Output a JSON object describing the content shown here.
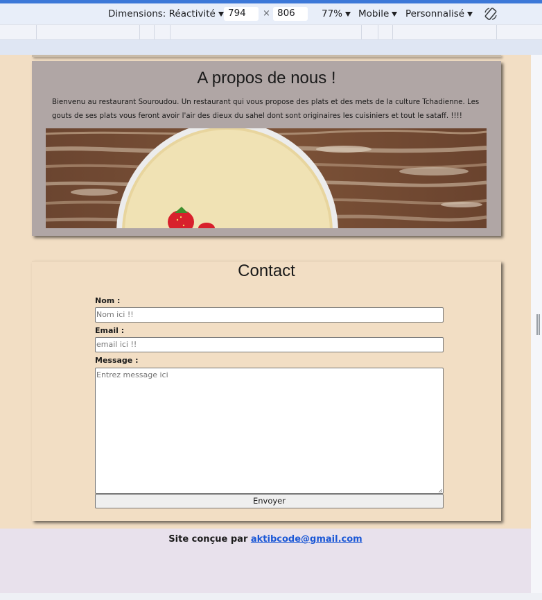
{
  "devtools": {
    "dimensions_label": "Dimensions: Réactivité",
    "width": "794",
    "height": "806",
    "times": "×",
    "zoom": "77%",
    "throttle": "Mobile",
    "custom": "Personnalisé",
    "accent": "#3c78d8"
  },
  "about": {
    "title": "A propos de nous !",
    "text": "Bienvenu au restaurant Souroudou. Un restaurant qui vous propose des plats et des mets de la culture Tchadienne. Les gouts de ses plats vous feront avoir l'air des dieux du sahel dont sont originaires les cuisiniers et tout le sataff. !!!!"
  },
  "contact": {
    "title": "Contact",
    "name_label": "Nom :",
    "name_placeholder": "Nom ici !!",
    "email_label": "Email :",
    "email_placeholder": "email ici !!",
    "message_label": "Message :",
    "message_placeholder": "Entrez message ici",
    "submit": "Envoyer"
  },
  "footer": {
    "prefix": "Site conçue par ",
    "email": "aktibcode@gmail.com"
  },
  "colors": {
    "page_bg": "#f2dec4",
    "about_bg": "#b0a6a5",
    "footer_bg": "#e8e1ec",
    "link": "#1a57d6"
  }
}
